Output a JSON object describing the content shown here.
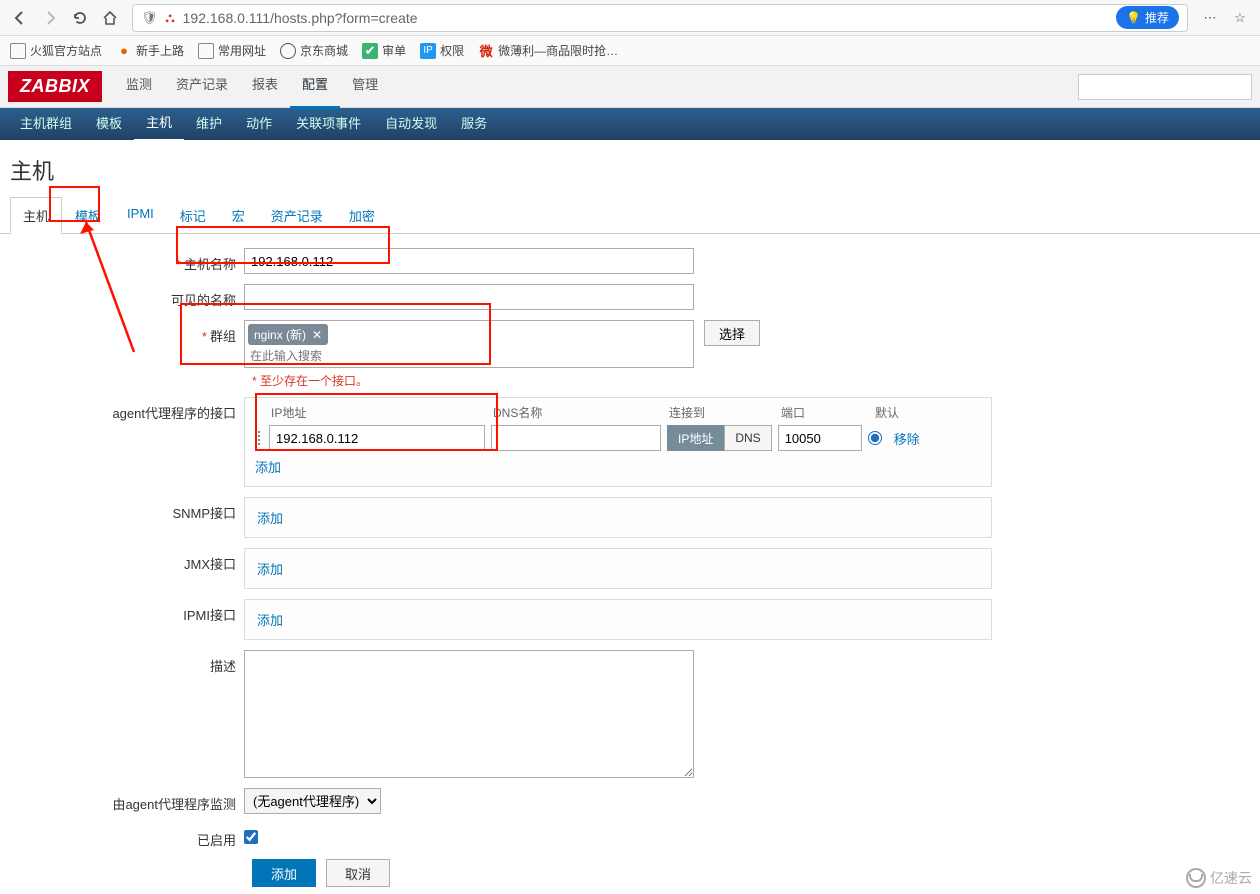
{
  "browser": {
    "url": "192.168.0.111/hosts.php?form=create",
    "recommend": "推荐",
    "bookmarks": [
      {
        "icon": "folder",
        "label": "火狐官方站点"
      },
      {
        "icon": "firefox",
        "label": "新手上路"
      },
      {
        "icon": "folder",
        "label": "常用网址"
      },
      {
        "icon": "globe",
        "label": "京东商城"
      },
      {
        "icon": "check",
        "label": "审单"
      },
      {
        "icon": "ip",
        "label": "权限"
      },
      {
        "icon": "wei",
        "label": "微薄利—商品限时抢…"
      }
    ]
  },
  "zabbix": {
    "logo": "ZABBIX",
    "top_menu": [
      "监测",
      "资产记录",
      "报表",
      "配置",
      "管理"
    ],
    "top_menu_active": 3,
    "sub_menu": [
      "主机群组",
      "模板",
      "主机",
      "维护",
      "动作",
      "关联项事件",
      "自动发现",
      "服务"
    ],
    "sub_menu_active": 2,
    "page_title": "主机",
    "form_tabs": [
      "主机",
      "模板",
      "IPMI",
      "标记",
      "宏",
      "资产记录",
      "加密"
    ],
    "form_tab_active": 0
  },
  "form": {
    "host_name_label": "主机名称",
    "host_name_value": "192.168.0.112",
    "visible_name_label": "可见的名称",
    "visible_name_value": "",
    "groups_label": "群组",
    "groups_tag": "nginx (新)",
    "groups_placeholder": "在此输入搜索",
    "select_button": "选择",
    "interface_error": "至少存在一个接口。",
    "agent_label": "agent代理程序的接口",
    "iface_headers": {
      "ip": "IP地址",
      "dns": "DNS名称",
      "connect": "连接到",
      "port": "端口",
      "default": "默认"
    },
    "agent_ip": "192.168.0.112",
    "agent_dns": "",
    "agent_connect_ip": "IP地址",
    "agent_connect_dns": "DNS",
    "agent_port": "10050",
    "remove_link": "移除",
    "add_link": "添加",
    "snmp_label": "SNMP接口",
    "jmx_label": "JMX接口",
    "ipmi_label": "IPMI接口",
    "description_label": "描述",
    "description_value": "",
    "monitored_by_label": "由agent代理程序监测",
    "monitored_by_value": "(无agent代理程序)",
    "enabled_label": "已启用",
    "submit": "添加",
    "cancel": "取消"
  },
  "watermark": "亿速云"
}
